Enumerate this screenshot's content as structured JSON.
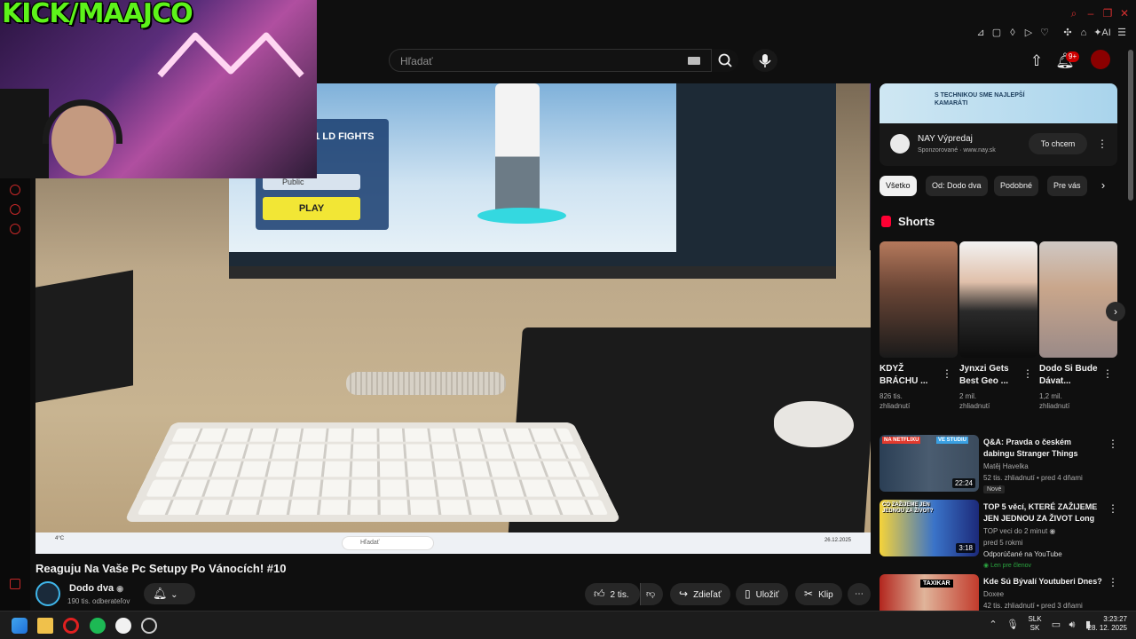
{
  "overlay": {
    "kick_title": "KICK/MAAJCO"
  },
  "header": {
    "search_placeholder": "Hľadať",
    "notif_count": "9+"
  },
  "player": {
    "game_title": "DODEU 1V1 LD FIGHTS",
    "game_public": "Public",
    "game_play": "PLAY",
    "taskbar_search": "Hľadať",
    "taskbar_temp": "4°C",
    "taskbar_date": "26.12.2025"
  },
  "video": {
    "title": "Reaguju Na Vaše Pc Setupy Po Vánocích! #10",
    "channel_name": "Dodo dva",
    "channel_subs": "190 tis. odberateľov",
    "likes": "2 tis.",
    "share_label": "Zdieľať",
    "save_label": "Uložiť",
    "clip_label": "Klip"
  },
  "ad": {
    "banner_text": "S TECHNIKOU SME NAJLEPŠÍ KAMARÁTI",
    "title": "NAY Výpredaj",
    "sponsor": "Sponzorované · www.nay.sk",
    "cta": "To chcem"
  },
  "chips": [
    "Všetko",
    "Od: Dodo dva",
    "Podobné",
    "Pre vás"
  ],
  "shorts": {
    "label": "Shorts",
    "items": [
      {
        "title": "KDYŽ BRÁCHU ...",
        "views": "826 tis.",
        "views2": "zhliadnutí"
      },
      {
        "title": "Jynxzi Gets Best Geo ...",
        "views": "2 mil.",
        "views2": "zhliadnutí"
      },
      {
        "title": "Dodo Si Bude Dávat...",
        "views": "1,2 mil.",
        "views2": "zhliadnutí"
      }
    ]
  },
  "recommendations": [
    {
      "title": "Q&A: Pravda o českém dabingu Stranger Things",
      "channel": "Matěj Havelka",
      "meta": "52 tis. zhliadnutí • pred 4 dňami",
      "badge": "Nové",
      "duration": "22:24",
      "thumb_text_1": "NA NETFLIXU",
      "thumb_text_2": "VE STUDIU"
    },
    {
      "title": "TOP 5 věcí, KTERÉ ZAŽIJEME JEN JEDNOU ZA ŽIVOT Long",
      "channel": "TOP veci do 2 minut",
      "meta": "pred 5 rokmi",
      "extra": "Odporúčané na YouTube",
      "badge": "Len pre členov",
      "duration": "3:18",
      "thumb_text_1": "CO ZAŽIJEME JEN JEDNOU ZA ŽIVOT?"
    },
    {
      "title": "Kde Sú Bývalí Youtuberi Dnes?",
      "channel": "Doxee",
      "meta": "42 tis. zhliadnutí • pred 3 dňami",
      "thumb_text_1": "TAXIKAR"
    }
  ],
  "system": {
    "lang_1": "SLK",
    "lang_2": "SK",
    "time": "3:23:27",
    "date": "28. 12. 2025"
  }
}
